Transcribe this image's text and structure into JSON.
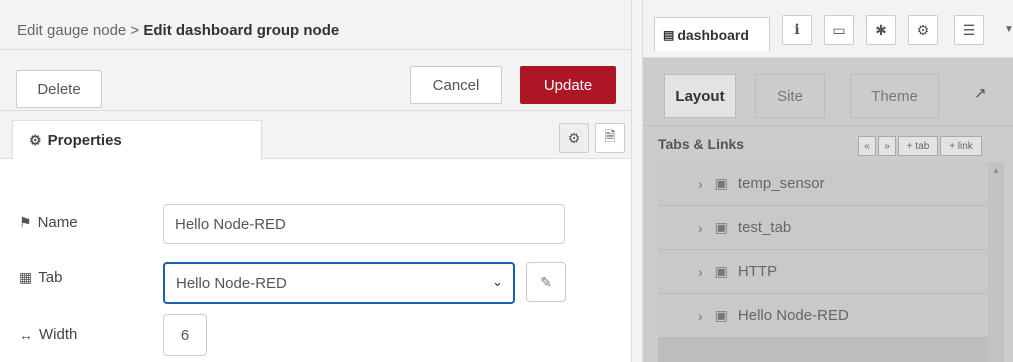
{
  "editor": {
    "breadcrumb_parent": "Edit gauge node >",
    "breadcrumb_current": "Edit dashboard group node",
    "delete_label": "Delete",
    "cancel_label": "Cancel",
    "update_label": "Update",
    "properties_tab_label": "Properties",
    "fields": {
      "name_label": "Name",
      "name_value": "Hello Node-RED",
      "tab_label": "Tab",
      "tab_value": "Hello Node-RED",
      "width_label": "Width",
      "width_value": "6"
    }
  },
  "sidebar": {
    "dashboard_tab_label": "dashboard",
    "icons": [
      "info-icon",
      "book-icon",
      "bug-icon",
      "gear-icon",
      "database-icon"
    ],
    "dash_tabs": [
      "Layout",
      "Site",
      "Theme"
    ],
    "section_title": "Tabs & Links",
    "mini_buttons": [
      "«",
      "»",
      "+ tab",
      "+ link"
    ],
    "tree_items": [
      "temp_sensor",
      "test_tab",
      "HTTP",
      "Hello Node-RED"
    ]
  },
  "colors": {
    "update_button": "#ad1625",
    "focus_border": "#1a5fb4"
  }
}
